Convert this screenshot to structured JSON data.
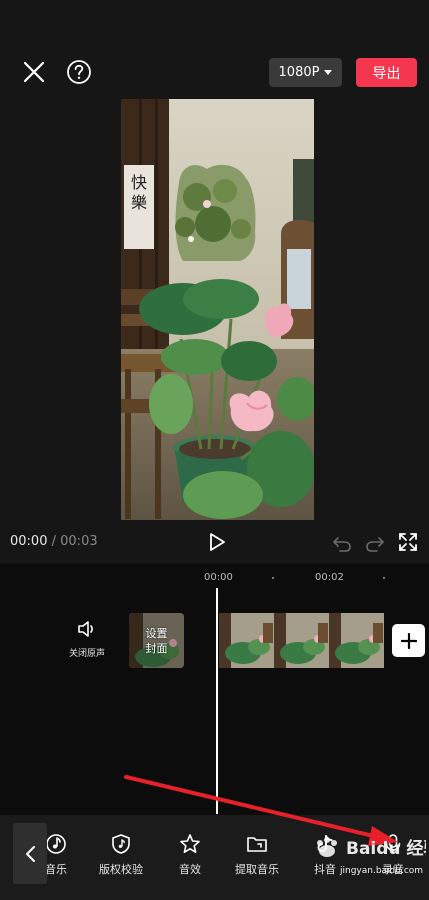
{
  "header": {
    "close_icon": "close-icon",
    "help_icon": "help-icon",
    "resolution": "1080P",
    "export_label": "导出",
    "accent": "#f4364f"
  },
  "preview": {
    "calligraphy": "快樂"
  },
  "playback": {
    "current_time": "00:00",
    "separator": "/",
    "duration": "00:03"
  },
  "timeline": {
    "ticks": [
      "00:00",
      "00:02"
    ],
    "mute_label": "关闭原声",
    "cover_label_line1": "设置",
    "cover_label_line2": "封面"
  },
  "toolbar": {
    "items": [
      {
        "label": "音乐",
        "icon": "music-icon"
      },
      {
        "label": "版权校验",
        "icon": "copyright-shield-icon"
      },
      {
        "label": "音效",
        "icon": "sound-effect-icon"
      },
      {
        "label": "提取音乐",
        "icon": "extract-music-folder-icon"
      },
      {
        "label": "抖音",
        "icon": "douyin-icon"
      },
      {
        "label": "录音",
        "icon": "microphone-icon"
      }
    ]
  },
  "watermark": {
    "brand": "Baidu 经验",
    "url": "jingyan.baidu.com"
  }
}
